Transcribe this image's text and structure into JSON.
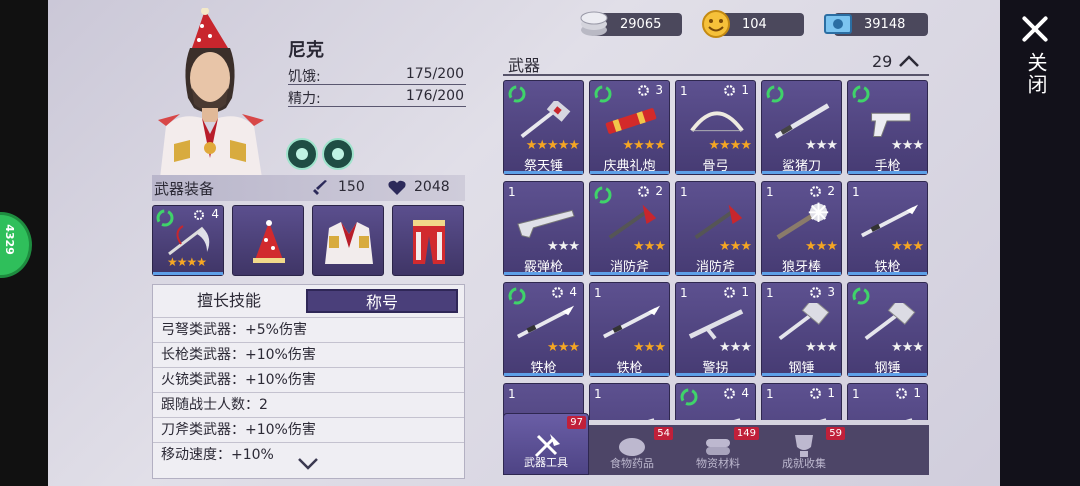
{
  "side_badge": "4329",
  "close": {
    "label": "关闭"
  },
  "character": {
    "name": "尼克",
    "stats": [
      {
        "label": "饥饿:",
        "value": "175/200"
      },
      {
        "label": "精力:",
        "value": "176/200"
      }
    ]
  },
  "equipment": {
    "title": "武器装备",
    "attack": "150",
    "health": "2048",
    "slots": [
      {
        "kind": "weapon",
        "level": "4",
        "stars": 3
      },
      {
        "kind": "hat"
      },
      {
        "kind": "coat"
      },
      {
        "kind": "pants"
      }
    ]
  },
  "skills": {
    "tabs": [
      "擅长技能",
      "称号"
    ],
    "active_tab": 1,
    "rows": [
      "弓弩类武器：+5%伤害",
      "长枪类武器：+10%伤害",
      "火铳类武器：+10%伤害",
      "跟随战士人数：2",
      "刀斧类武器：+10%伤害",
      "移动速度：+10%"
    ]
  },
  "currency": [
    {
      "icon": "coin-stack-icon",
      "value": "29065"
    },
    {
      "icon": "smiley-token-icon",
      "value": "104"
    },
    {
      "icon": "cash-bill-icon",
      "value": "39148"
    }
  ],
  "weapons": {
    "title": "武器",
    "count": "29",
    "items": [
      {
        "name": "祭天锤",
        "qty": "",
        "recycle": true,
        "level": "",
        "stars": 5,
        "max": 5
      },
      {
        "name": "庆典礼炮",
        "qty": "",
        "recycle": true,
        "level": "3",
        "stars": 4,
        "max": 4
      },
      {
        "name": "骨弓",
        "qty": "1",
        "recycle": false,
        "level": "1",
        "stars": 4,
        "max": 4
      },
      {
        "name": "鲨猪刀",
        "qty": "",
        "recycle": true,
        "level": "",
        "stars": 0,
        "max": 3
      },
      {
        "name": "手枪",
        "qty": "",
        "recycle": true,
        "level": "",
        "stars": 0,
        "max": 3
      },
      {
        "name": "霰弹枪",
        "qty": "1",
        "recycle": false,
        "level": "",
        "stars": 0,
        "max": 3
      },
      {
        "name": "消防斧",
        "qty": "",
        "recycle": true,
        "level": "2",
        "stars": 3,
        "max": 3
      },
      {
        "name": "消防斧",
        "qty": "1",
        "recycle": false,
        "level": "",
        "stars": 3,
        "max": 3
      },
      {
        "name": "狼牙棒",
        "qty": "1",
        "recycle": false,
        "level": "2",
        "stars": 3,
        "max": 3
      },
      {
        "name": "铁枪",
        "qty": "1",
        "recycle": false,
        "level": "",
        "stars": 3,
        "max": 3
      },
      {
        "name": "铁枪",
        "qty": "",
        "recycle": true,
        "level": "4",
        "stars": 3,
        "max": 3
      },
      {
        "name": "铁枪",
        "qty": "1",
        "recycle": false,
        "level": "",
        "stars": 3,
        "max": 3
      },
      {
        "name": "警拐",
        "qty": "1",
        "recycle": false,
        "level": "1",
        "stars": 0,
        "max": 3
      },
      {
        "name": "钢锤",
        "qty": "1",
        "recycle": false,
        "level": "3",
        "stars": 0,
        "max": 3
      },
      {
        "name": "钢锤",
        "qty": "",
        "recycle": true,
        "level": "",
        "stars": 0,
        "max": 3
      },
      {
        "name": "",
        "qty": "1",
        "recycle": false,
        "level": "",
        "stars": 0,
        "max": 0
      },
      {
        "name": "",
        "qty": "1",
        "recycle": false,
        "level": "",
        "stars": 0,
        "max": 0
      },
      {
        "name": "",
        "qty": "",
        "recycle": true,
        "level": "4",
        "stars": 0,
        "max": 0
      },
      {
        "name": "",
        "qty": "1",
        "recycle": false,
        "level": "1",
        "stars": 0,
        "max": 0
      },
      {
        "name": "",
        "qty": "1",
        "recycle": false,
        "level": "1",
        "stars": 0,
        "max": 0
      }
    ]
  },
  "bottom_tabs": [
    {
      "label": "武器工具",
      "badge": "97",
      "active": true
    },
    {
      "label": "食物药品",
      "badge": "54",
      "active": false
    },
    {
      "label": "物资材料",
      "badge": "149",
      "active": false
    },
    {
      "label": "成就收集",
      "badge": "59",
      "active": false
    }
  ],
  "colors": {
    "card_bg": "#52468a",
    "star_on": "#f5a623",
    "badge": "#c0203a",
    "accent_green": "#2fbf5b"
  }
}
